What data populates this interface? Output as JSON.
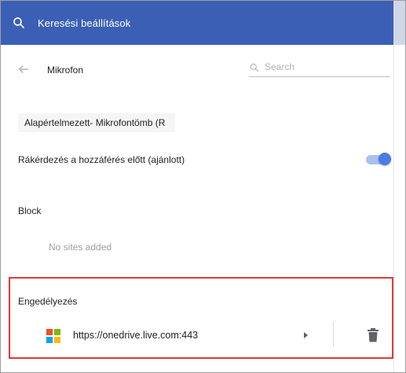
{
  "topbar": {
    "search_placeholder": "Keresési beállítások",
    "color": "#3b5fb5"
  },
  "subheader": {
    "title": "Mikrofon",
    "filter_placeholder": "Search"
  },
  "device": {
    "selected": "Alapértelmezett- Mikrofontömb (R"
  },
  "ask_before_access": {
    "label": "Rákérdezés a hozzáférés előtt (ajánlott)",
    "enabled": true,
    "accent_color": "#4a7ce6"
  },
  "block": {
    "label": "Block",
    "empty_text": "No sites added"
  },
  "allow": {
    "label": "Engedélyezés",
    "highlight_color": "#e03a3a",
    "sites": [
      {
        "url": "https://onedrive.live.com:443",
        "icon": "microsoft-logo-icon"
      }
    ]
  },
  "icons": {
    "search": "search-icon",
    "back": "back-arrow-icon",
    "filter": "search-icon",
    "expand": "triangle-right-icon",
    "delete": "trash-icon"
  },
  "colors": {
    "ms_red": "#f25022",
    "ms_green": "#7fba00",
    "ms_blue": "#00a4ef",
    "ms_yellow": "#ffb900"
  }
}
